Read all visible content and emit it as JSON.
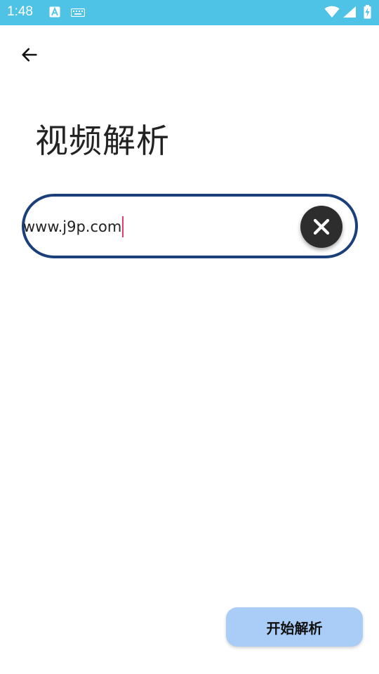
{
  "status_bar": {
    "time": "1:48",
    "icons": [
      "font-a-icon",
      "keyboard-icon",
      "wifi-icon",
      "cell-signal-icon",
      "battery-charging-icon"
    ],
    "background": "#4fc3e6"
  },
  "header": {
    "back_icon": "arrow-left-icon"
  },
  "page": {
    "title": "视频解析"
  },
  "url_input": {
    "value": "www.j9p.com",
    "border_color": "#1b3f7a",
    "cursor_color": "#e23c78",
    "clear_icon": "close-icon"
  },
  "actions": {
    "start_label": "开始解析",
    "start_color": "#a9cdf6"
  }
}
